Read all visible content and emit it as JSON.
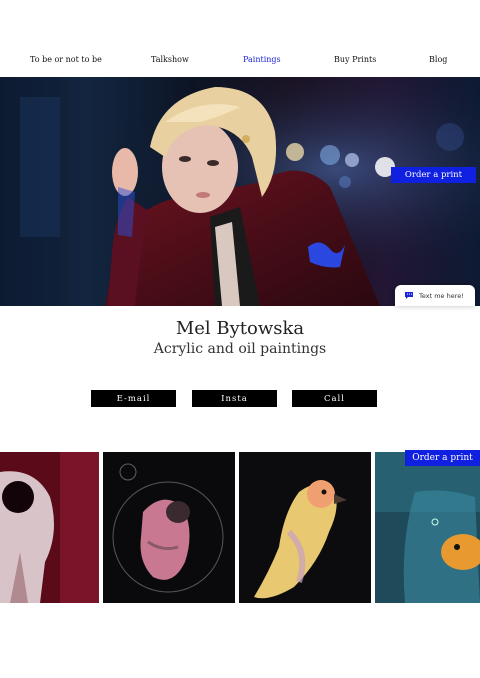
{
  "nav": {
    "items": [
      {
        "label": "To be or not to be",
        "active": false
      },
      {
        "label": "Talkshow",
        "active": false
      },
      {
        "label": "Paintings",
        "active": true
      },
      {
        "label": "Buy Prints",
        "active": false
      },
      {
        "label": "Blog",
        "active": false
      }
    ]
  },
  "hero": {
    "order_label": "Order a print"
  },
  "chat": {
    "label": "Text me here!",
    "icon": "chat-bubble-icon"
  },
  "artist": {
    "name": "Mel Bytowska",
    "subtitle": "Acrylic and oil paintings"
  },
  "actions": {
    "email": "E-mail",
    "insta": "Insta",
    "call": "Call"
  },
  "gallery": {
    "order_label": "Order a print",
    "tiles": [
      {
        "subject": "skull-like figure in red"
      },
      {
        "subject": "pink creature in bubble"
      },
      {
        "subject": "yellow canary bird"
      },
      {
        "subject": "goldfish in jar"
      }
    ]
  },
  "colors": {
    "accent": "#1a24d9",
    "button_blue": "#1020e0",
    "cta_bg": "#000000"
  }
}
